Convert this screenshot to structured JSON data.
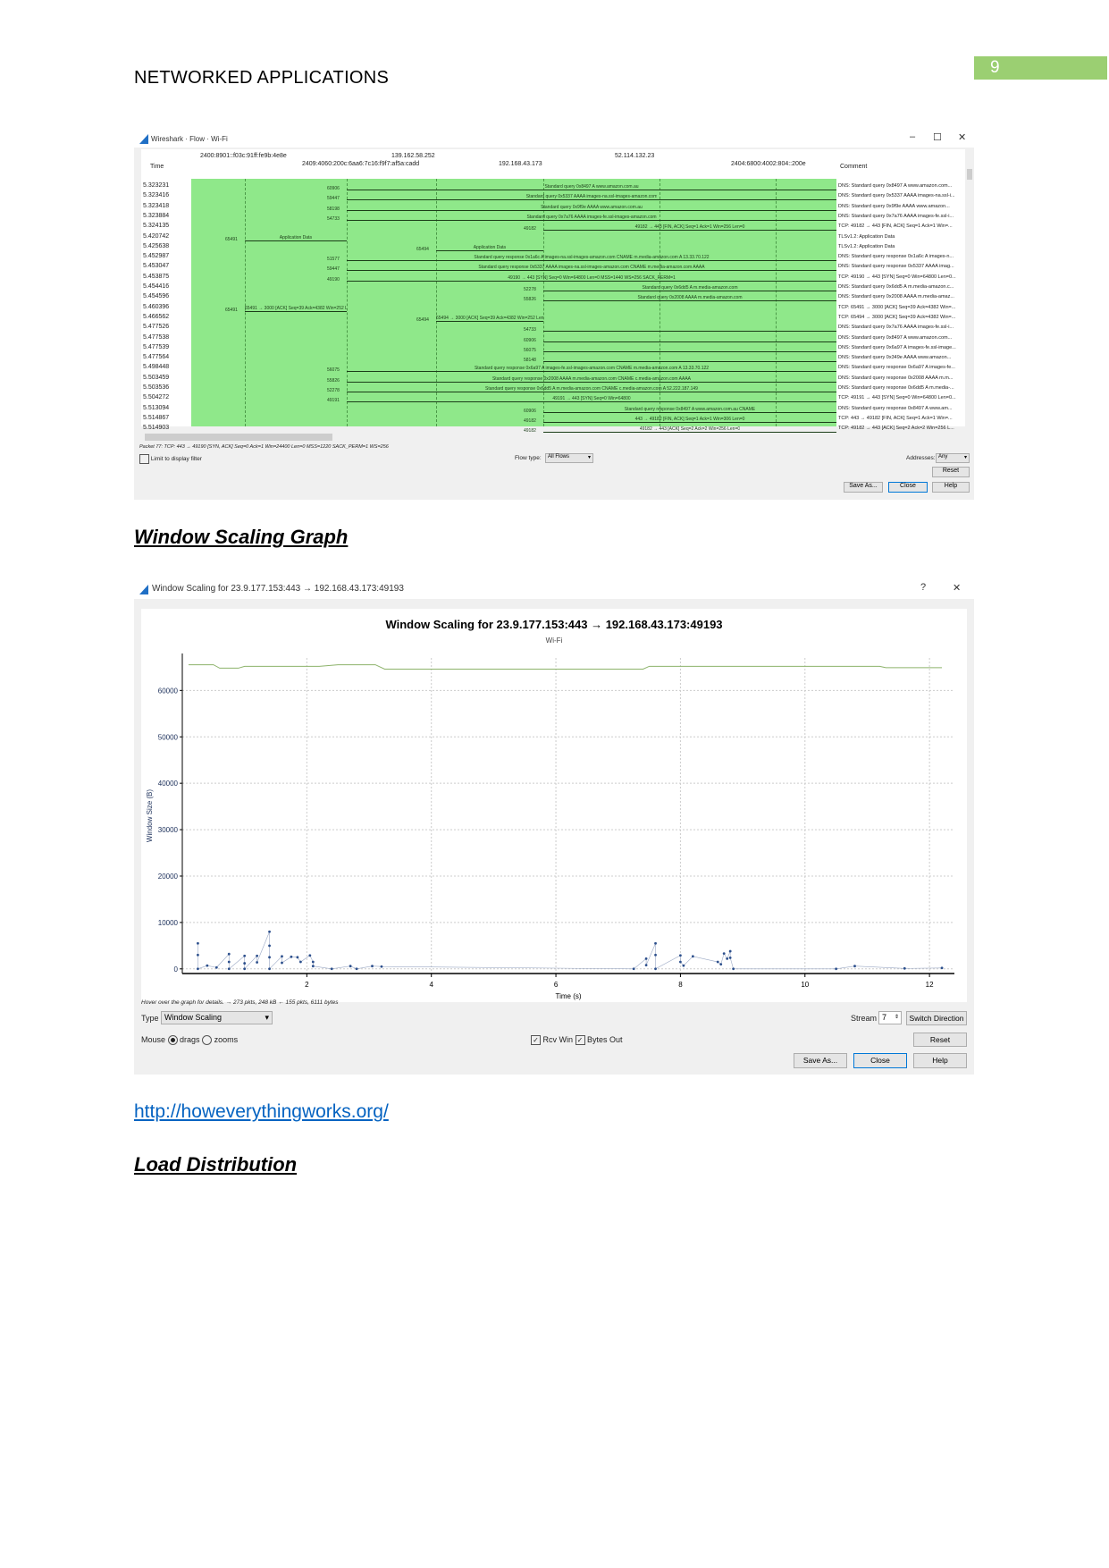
{
  "header": {
    "title": "NETWORKED APPLICATIONS",
    "page_number": "9",
    "accent": "#9bcf72"
  },
  "headings": {
    "window_scaling": "Window Scaling Graph",
    "load_distribution": "Load Distribution"
  },
  "link": "http://howeverythingworks.org/",
  "flow_window": {
    "title": "Wireshark · Flow · Wi-Fi",
    "controls": [
      "–",
      "☐",
      "✕"
    ],
    "time_header": "Time",
    "comment_header": "Comment",
    "hosts": [
      "2400:8901::f03c:91ff:fe9b:4e8e",
      "2409:4060:200c:6aa6:7c16:f9f7:af5a:cadd",
      "139.162.58.252",
      "192.168.43.173",
      "52.114.132.23",
      "2404:6800:4002:804::200e"
    ],
    "rows": [
      {
        "time": "5.323231",
        "label": "Standard query 0x8497 A www.amazon.com.au",
        "port": "60906",
        "comment": "DNS: Standard query 0x8497 A www.amazon.com..."
      },
      {
        "time": "5.323416",
        "label": "Standard query 0x5337 AAAA images-na.ssl-images-amazon.com",
        "port": "59447",
        "comment": "DNS: Standard query 0x5337 AAAA images-na.ssl-i..."
      },
      {
        "time": "5.323418",
        "label": "Standard query 0x9f9e AAAA www.amazon.com.au",
        "port": "58198",
        "comment": "DNS: Standard query 0x9f9e AAAA www.amazon..."
      },
      {
        "time": "5.323884",
        "label": "Standard query 0x7a76 AAAA images-fe.ssl-images-amazon.com",
        "port": "54733",
        "comment": "DNS: Standard query 0x7a76 AAAA images-fe.ssl-i..."
      },
      {
        "time": "5.324135",
        "label": "49182 → 443 [FIN, ACK] Seq=1 Ack=1 Win=256 Len=0",
        "port": "49182",
        "comment": "TCP: 49182 → 443 [FIN, ACK] Seq=1 Ack=1 Win=..."
      },
      {
        "time": "5.420742",
        "label": "Application Data",
        "port": "65491",
        "comment": "TLSv1.2: Application Data"
      },
      {
        "time": "5.425638",
        "label": "Application Data",
        "port": "65494",
        "comment": "TLSv1.2: Application Data"
      },
      {
        "time": "5.452987",
        "label": "Standard query response 0x1a6c A images-na.ssl-images-amazon.com CNAME m.media-amazon.com A 13.33.70.122",
        "port": "51577",
        "comment": "DNS: Standard query response 0x1a6c A images-n..."
      },
      {
        "time": "5.453047",
        "label": "Standard query response 0x5337 AAAA images-na.ssl-images-amazon.com CNAME m.media-amazon.com AAAA",
        "port": "59447",
        "comment": "DNS: Standard query response 0x5337 AAAA imag..."
      },
      {
        "time": "5.453875",
        "label": "49190 → 443 [SYN] Seq=0 Win=64800 Len=0 MSS=1440 WS=256 SACK_PERM=1",
        "port": "49190",
        "comment": "TCP: 49190 → 443 [SYN] Seq=0 Win=64800 Len=0..."
      },
      {
        "time": "5.454416",
        "label": "Standard query 0x6dd5 A m.media-amazon.com",
        "port": "52278",
        "comment": "DNS: Standard query 0x6dd5 A m.media-amazon.c..."
      },
      {
        "time": "5.454596",
        "label": "Standard query 0x2008 AAAA m.media-amazon.com",
        "port": "55826",
        "comment": "DNS: Standard query 0x2008 AAAA m.media-amaz..."
      },
      {
        "time": "5.460396",
        "label": "65491 → 3000 [ACK] Seq=39 Ack=4382 Win=252 Len=0",
        "port": "65491",
        "comment": "TCP: 65491 → 3000 [ACK] Seq=39 Ack=4382 Win=..."
      },
      {
        "time": "5.466562",
        "label": "65494 → 3000 [ACK] Seq=39 Ack=4382 Win=252 Len=0",
        "port": "65494",
        "comment": "TCP: 65494 → 3000 [ACK] Seq=39 Ack=4382 Win=..."
      },
      {
        "time": "5.477526",
        "label": "",
        "port": "54733",
        "comment": "DNS: Standard query 0x7a76 AAAA images-fe.ssl-i..."
      },
      {
        "time": "5.477538",
        "label": "",
        "port": "60906",
        "comment": "DNS: Standard query 0x8497 A www.amazon.com..."
      },
      {
        "time": "5.477539",
        "label": "",
        "port": "56075",
        "comment": "DNS: Standard query 0x6a97 A images-fe.ssl-image..."
      },
      {
        "time": "5.477564",
        "label": "",
        "port": "58148",
        "comment": "DNS: Standard query 0x349e AAAA www.amazon..."
      },
      {
        "time": "5.498448",
        "label": "Standard query response 0x6a97 A images-fe.ssl-images-amazon.com CNAME m.media-amazon.com A 13.33.70.122",
        "port": "56075",
        "comment": "DNS: Standard query response 0x6a97 A images-fe..."
      },
      {
        "time": "5.503459",
        "label": "Standard query response 0x2008 AAAA m.media-amazon.com CNAME c.media-amazon.com AAAA",
        "port": "55826",
        "comment": "DNS: Standard query response 0x2008 AAAA m.m..."
      },
      {
        "time": "5.503536",
        "label": "Standard query response 0x6dd5 A m.media-amazon.com CNAME c.media-amazon.com A 52.222.187.149",
        "port": "52278",
        "comment": "DNS: Standard query response 0x6dd5 A m.media-..."
      },
      {
        "time": "5.504272",
        "label": "49191 → 443 [SYN] Seq=0 Win=64800",
        "port": "49191",
        "comment": "TCP: 49191 → 443 [SYN] Seq=0 Win=64800 Len=0..."
      },
      {
        "time": "5.513094",
        "label": "Standard query response 0x8497 A www.amazon.com.au CNAME",
        "port": "60906",
        "comment": "DNS: Standard query response 0x8497 A www.am..."
      },
      {
        "time": "5.514867",
        "label": "443 → 49182 [FIN, ACK] Seq=1 Ack=1 Win=306 Len=0",
        "port": "49182",
        "comment": "TCP: 443 → 49182 [FIN, ACK] Seq=1 Ack=1 Win=..."
      },
      {
        "time": "5.514903",
        "label": "49182 → 443 [ACK] Seq=2 Ack=2 Win=256 Len=0",
        "port": "49182",
        "comment": "TCP: 49182 → 443 [ACK] Seq=2 Ack=2 Win=256 L..."
      }
    ],
    "packet_info": "Packet 77: TCP: 443 → 49190 [SYN, ACK] Seq=0 Ack=1 Win=24400 Len=0 MSS=1220 SACK_PERM=1 WS=256",
    "limit_filter_label": "Limit to display filter",
    "flow_type_label": "Flow type:",
    "flow_type_value": "All Flows",
    "addresses_label": "Addresses:",
    "addresses_value": "Any",
    "buttons": {
      "reset": "Reset",
      "save_as": "Save As...",
      "close": "Close",
      "help": "Help"
    },
    "flow_color": "#8fe88a"
  },
  "scaling_window": {
    "title": "Window Scaling for 23.9.177.153:443 → 192.168.43.173:49193",
    "controls": [
      "?",
      "✕"
    ],
    "hover_info": "Hover over the graph for details. → 273 pkts, 248 kB ← 155 pkts, 6111 bytes",
    "type_label": "Type",
    "type_value": "Window Scaling",
    "mouse_label": "Mouse",
    "mouse_drags": "drags",
    "mouse_zooms": "zooms",
    "rcv_win_label": "Rcv Win",
    "bytes_out_label": "Bytes Out",
    "stream_label": "Stream",
    "stream_value": "7",
    "buttons": {
      "switch": "Switch Direction",
      "reset": "Reset",
      "save_as": "Save As...",
      "close": "Close",
      "help": "Help"
    }
  },
  "chart_data": {
    "type": "line",
    "title": "Window Scaling for 23.9.177.153:443 → 192.168.43.173:49193",
    "subtitle": "Wi-Fi",
    "xlabel": "Time (s)",
    "ylabel": "Window Size (B)",
    "xlim": [
      0,
      12.4
    ],
    "ylim": [
      -1000,
      67000
    ],
    "xticks": [
      "2",
      "4",
      "6",
      "8",
      "10",
      "12"
    ],
    "yticks": [
      "0",
      "10000",
      "20000",
      "30000",
      "40000",
      "50000",
      "60000"
    ],
    "grid": true,
    "series": [
      {
        "name": "Rcv Win",
        "color": "#8db36b",
        "style": "step",
        "points": [
          [
            0.1,
            65535
          ],
          [
            0.5,
            65535
          ],
          [
            0.6,
            64800
          ],
          [
            0.9,
            64800
          ],
          [
            1.0,
            65200
          ],
          [
            2.2,
            65200
          ],
          [
            2.5,
            65535
          ],
          [
            3.1,
            65535
          ],
          [
            3.25,
            64600
          ],
          [
            7.4,
            64600
          ],
          [
            7.5,
            65200
          ],
          [
            11.2,
            65200
          ],
          [
            11.3,
            64900
          ],
          [
            12.2,
            64900
          ]
        ]
      },
      {
        "name": "Bytes Out",
        "color": "#2c4f8c",
        "style": "points",
        "points": [
          [
            0.25,
            5500
          ],
          [
            0.25,
            3000
          ],
          [
            0.25,
            0
          ],
          [
            0.4,
            700
          ],
          [
            0.55,
            300
          ],
          [
            0.75,
            3200
          ],
          [
            0.75,
            1500
          ],
          [
            0.75,
            0
          ],
          [
            1.0,
            2800
          ],
          [
            1.0,
            1200
          ],
          [
            1.0,
            0
          ],
          [
            1.2,
            2800
          ],
          [
            1.2,
            1400
          ],
          [
            1.4,
            8000
          ],
          [
            1.4,
            5000
          ],
          [
            1.4,
            2500
          ],
          [
            1.4,
            0
          ],
          [
            1.6,
            2700
          ],
          [
            1.6,
            1300
          ],
          [
            1.75,
            2600
          ],
          [
            1.85,
            2500
          ],
          [
            1.9,
            1500
          ],
          [
            2.05,
            2900
          ],
          [
            2.1,
            1500
          ],
          [
            2.1,
            600
          ],
          [
            2.4,
            0
          ],
          [
            2.7,
            600
          ],
          [
            2.8,
            0
          ],
          [
            3.05,
            600
          ],
          [
            3.2,
            500
          ],
          [
            7.25,
            0
          ],
          [
            7.45,
            2200
          ],
          [
            7.45,
            800
          ],
          [
            7.6,
            5500
          ],
          [
            7.6,
            3000
          ],
          [
            7.6,
            0
          ],
          [
            8.0,
            2900
          ],
          [
            8.0,
            1500
          ],
          [
            8.05,
            700
          ],
          [
            8.2,
            2700
          ],
          [
            8.6,
            1500
          ],
          [
            8.65,
            1000
          ],
          [
            8.7,
            3300
          ],
          [
            8.75,
            2200
          ],
          [
            8.8,
            3800
          ],
          [
            8.8,
            2400
          ],
          [
            8.85,
            0
          ],
          [
            10.5,
            0
          ],
          [
            10.8,
            600
          ],
          [
            11.6,
            100
          ],
          [
            12.2,
            200
          ]
        ]
      }
    ]
  }
}
